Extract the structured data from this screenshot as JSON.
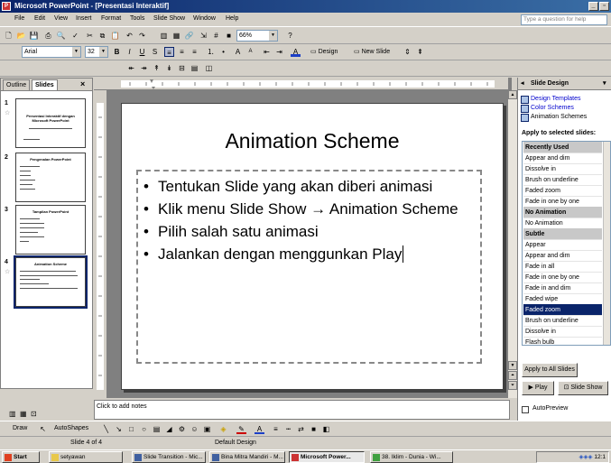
{
  "window": {
    "title": "Microsoft PowerPoint - [Presentasi Interaktif]"
  },
  "menu": [
    "File",
    "Edit",
    "View",
    "Insert",
    "Format",
    "Tools",
    "Slide Show",
    "Window",
    "Help"
  ],
  "ask_placeholder": "Type a question for help",
  "toolbar": {
    "zoom": "66%",
    "font": "Arial",
    "size": "32",
    "bold": "B",
    "italic": "I",
    "underline": "U",
    "shadow": "S",
    "design": "Design",
    "new_slide": "New Slide"
  },
  "left_pane": {
    "tabs": [
      "Outline",
      "Slides"
    ],
    "close": "×",
    "thumbs": [
      {
        "num": "1",
        "title": "Presentasi Interaktif dengan Microsoft PowerPoint"
      },
      {
        "num": "2",
        "title": "Pengenalan PowerPoint"
      },
      {
        "num": "3",
        "title": "Tampilan PowerPoint"
      },
      {
        "num": "4",
        "title": "Animation Scheme"
      }
    ]
  },
  "slide": {
    "title": "Animation Scheme",
    "bullets": [
      "Tentukan Slide yang akan diberi animasi",
      "Klik menu Slide Show → Animation Scheme",
      "Pilih salah satu animasi",
      "Jalankan dengan menggunkan Play"
    ]
  },
  "notes_placeholder": "Click to add notes",
  "task_pane": {
    "title": "Slide Design",
    "links": [
      "Design Templates",
      "Color Schemes",
      "Animation Schemes"
    ],
    "apply_label": "Apply to selected slides:",
    "items": [
      {
        "label": "Recently Used",
        "kind": "hdr"
      },
      {
        "label": "Appear and dim",
        "kind": "item"
      },
      {
        "label": "Dissolve in",
        "kind": "item"
      },
      {
        "label": "Brush on underline",
        "kind": "item"
      },
      {
        "label": "Faded zoom",
        "kind": "item"
      },
      {
        "label": "Fade in one by one",
        "kind": "item"
      },
      {
        "label": "No Animation",
        "kind": "hdr"
      },
      {
        "label": "No Animation",
        "kind": "item"
      },
      {
        "label": "Subtle",
        "kind": "hdr"
      },
      {
        "label": "Appear",
        "kind": "item"
      },
      {
        "label": "Appear and dim",
        "kind": "item"
      },
      {
        "label": "Fade in all",
        "kind": "item"
      },
      {
        "label": "Fade in one by one",
        "kind": "item"
      },
      {
        "label": "Fade in and dim",
        "kind": "item"
      },
      {
        "label": "Faded wipe",
        "kind": "item"
      },
      {
        "label": "Faded zoom",
        "kind": "sel"
      },
      {
        "label": "Brush on underline",
        "kind": "item"
      },
      {
        "label": "Dissolve in",
        "kind": "item"
      },
      {
        "label": "Flash bulb",
        "kind": "item"
      }
    ],
    "apply_all": "Apply to All Slides",
    "play": "Play",
    "slide_show": "Slide Show",
    "autopreview": "AutoPreview"
  },
  "drawbar": {
    "draw": "Draw",
    "autoshapes": "AutoShapes"
  },
  "status": {
    "slide": "Slide 4 of 4",
    "design": "Default Design"
  },
  "taskbar": {
    "start": "Start",
    "tasks": [
      "setyawan",
      "Slide Transition - Mic...",
      "Bina Mitra Mandiri - M...",
      "Microsoft Power...",
      "38. Iklim - Dunia - Wi..."
    ],
    "clock": "12:1"
  }
}
